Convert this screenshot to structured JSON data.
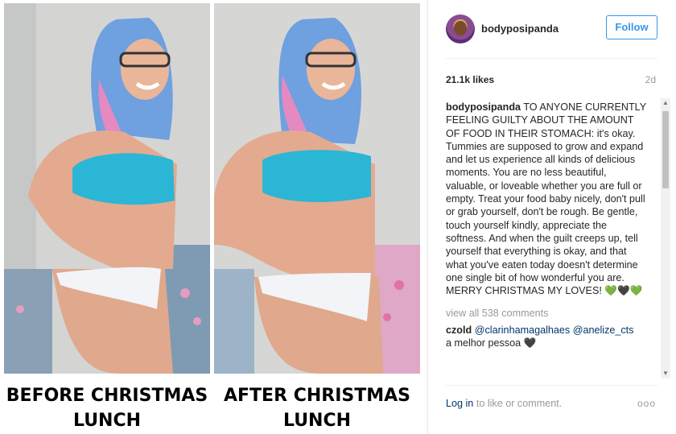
{
  "photos": {
    "left_caption": [
      "BEFORE CHRISTMAS",
      "LUNCH"
    ],
    "right_caption": [
      "AFTER CHRISTMAS",
      "LUNCH"
    ]
  },
  "header": {
    "username": "bodyposipanda",
    "follow_label": "Follow"
  },
  "meta": {
    "likes": "21.1k likes",
    "age": "2d"
  },
  "caption": {
    "username": "bodyposipanda",
    "text": "TO ANYONE CURRENTLY FEELING GUILTY ABOUT THE AMOUNT OF FOOD IN THEIR STOMACH: it's okay. Tummies are supposed to grow and expand and let us experience all kinds of delicious moments. You are no less beautiful, valuable, or loveable whether you are full or empty. Treat your food baby nicely, don't pull or grab yourself, don't be rough. Be gentle, touch yourself kindly, appreciate the softness. And when the guilt creeps up, tell yourself that everything is okay, and that what you've eaten today doesn't determine one single bit of how wonderful you are. MERRY CHRISTMAS MY LOVES! 💚🖤💚"
  },
  "comments": {
    "view_all": "view all 538 comments",
    "items": [
      {
        "user": "czold",
        "mention1": "@clarinhamagalhaes",
        "mention2": "@anelize_cts",
        "text": "a melhor pessoa 🖤"
      }
    ]
  },
  "footer": {
    "login": "Log in",
    "rest": " to like or comment.",
    "more": "ooo"
  },
  "colors": {
    "accent": "#3897f0",
    "hair": "#6fa0e0",
    "top": "#2bb6d6"
  }
}
